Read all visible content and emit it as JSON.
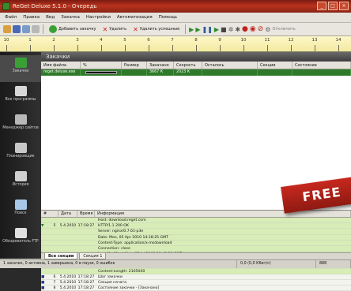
{
  "window": {
    "title": "ReGet Deluxe 5.1.0 - Очередь"
  },
  "menu": [
    "Файл",
    "Правка",
    "Вид",
    "Закачка",
    "Настройки",
    "Автоматизация",
    "Помощь"
  ],
  "toolbar": {
    "add_label": "Добавить закачку",
    "delete_label": "Удалить",
    "delete_completed_label": "Удалить успешные",
    "schedule_label": "Отключить"
  },
  "scale": {
    "marks": [
      "10",
      "1",
      "2",
      "3",
      "4",
      "5",
      "6",
      "7",
      "8",
      "9",
      "10",
      "11",
      "12",
      "13",
      "14"
    ]
  },
  "sidebar": {
    "items": [
      {
        "label": "Закачки",
        "icon": "downloads-icon",
        "color": "#3aa036"
      },
      {
        "label": "Все программы",
        "icon": "programs-icon",
        "color": "#d8d8d8"
      },
      {
        "label": "Менеджер сайтов",
        "icon": "site-manager-icon",
        "color": "#b8b8b8"
      },
      {
        "label": "Планировщик",
        "icon": "scheduler-icon",
        "color": "#c8c8c8"
      },
      {
        "label": "История",
        "icon": "history-icon",
        "color": "#d0d0d0"
      },
      {
        "label": "Поиск",
        "icon": "search-icon",
        "color": "#a8c8e8"
      },
      {
        "label": "Обозреватель FTP",
        "icon": "ftp-browser-icon",
        "color": "#e0e0e0"
      }
    ]
  },
  "main": {
    "section_title": "Закачки",
    "columns": [
      "Имя файла",
      "%",
      "Размер",
      "Закачано",
      "Скорость",
      "Осталось",
      "Секции",
      "Состояние"
    ],
    "rows": [
      {
        "name": "reget.deluxe.exe",
        "percent": "",
        "progress": 0.55,
        "size": "3667 К",
        "done": "2023 К",
        "speed": "",
        "left": "",
        "sections": "",
        "state": ""
      }
    ]
  },
  "log": {
    "columns": [
      "#",
      "Дата",
      "Время",
      "Информация"
    ],
    "rows": [
      {
        "marker": "",
        "num": "",
        "date": "",
        "time": "",
        "text": "Host: download.reget.com",
        "style": "green"
      },
      {
        "marker": "▼",
        "num": "5",
        "date": "5.4.2010",
        "time": "17:18:27",
        "text": "HTTP/1.1 200 OK",
        "style": "green"
      },
      {
        "marker": "",
        "num": "",
        "date": "",
        "time": "",
        "text": "Server: nginx/0.7.61-p3e",
        "style": "green"
      },
      {
        "marker": "",
        "num": "",
        "date": "",
        "time": "",
        "text": "Date: Mon, 05 Apr 2010 14:18:25 GMT",
        "style": "green"
      },
      {
        "marker": "",
        "num": "",
        "date": "",
        "time": "",
        "text": "Content-Type: application/x-msdownload",
        "style": "green"
      },
      {
        "marker": "",
        "num": "",
        "date": "",
        "time": "",
        "text": "Connection: close",
        "style": "green"
      },
      {
        "marker": "",
        "num": "",
        "date": "",
        "time": "",
        "text": "Last-Modified: Mon, 07 Jul 2008 21:45:58 GMT",
        "style": "green"
      },
      {
        "marker": "",
        "num": "",
        "date": "",
        "time": "",
        "text": "ETag: \"7bfc42e-2025d6-48720d0a\"",
        "style": "green"
      },
      {
        "marker": "",
        "num": "",
        "date": "",
        "time": "",
        "text": "Accept-Ranges: bytes",
        "style": "green"
      },
      {
        "marker": "",
        "num": "",
        "date": "",
        "time": "",
        "text": "Content-Length: 2105040",
        "style": "green"
      },
      {
        "marker": "■",
        "num": "6",
        "date": "5.4.2010",
        "time": "17:18:27",
        "text": "Шаг закачки",
        "style": "dim"
      },
      {
        "marker": "■",
        "num": "7",
        "date": "5.4.2010",
        "time": "17:18:27",
        "text": "Секция начата",
        "style": "dim"
      },
      {
        "marker": "■",
        "num": "8",
        "date": "5.4.2010",
        "time": "17:18:27",
        "text": "Состояние закачки - [Закачано]",
        "style": "dim"
      }
    ]
  },
  "banner": {
    "text": "FREE"
  },
  "tabs": [
    "Все секции",
    "Секция 1"
  ],
  "status": {
    "summary": "1 закачек, 0 активна, 1 завершена, 0 в паузе, 0 ошибок",
    "speed": "0,0 (0,0 Кбит/с)",
    "extra": "888"
  },
  "colors": {
    "accent": "#3aa036",
    "title_red": "#b8321e",
    "banner_red": "#c7281e",
    "log_green": "#d8ecb8"
  }
}
